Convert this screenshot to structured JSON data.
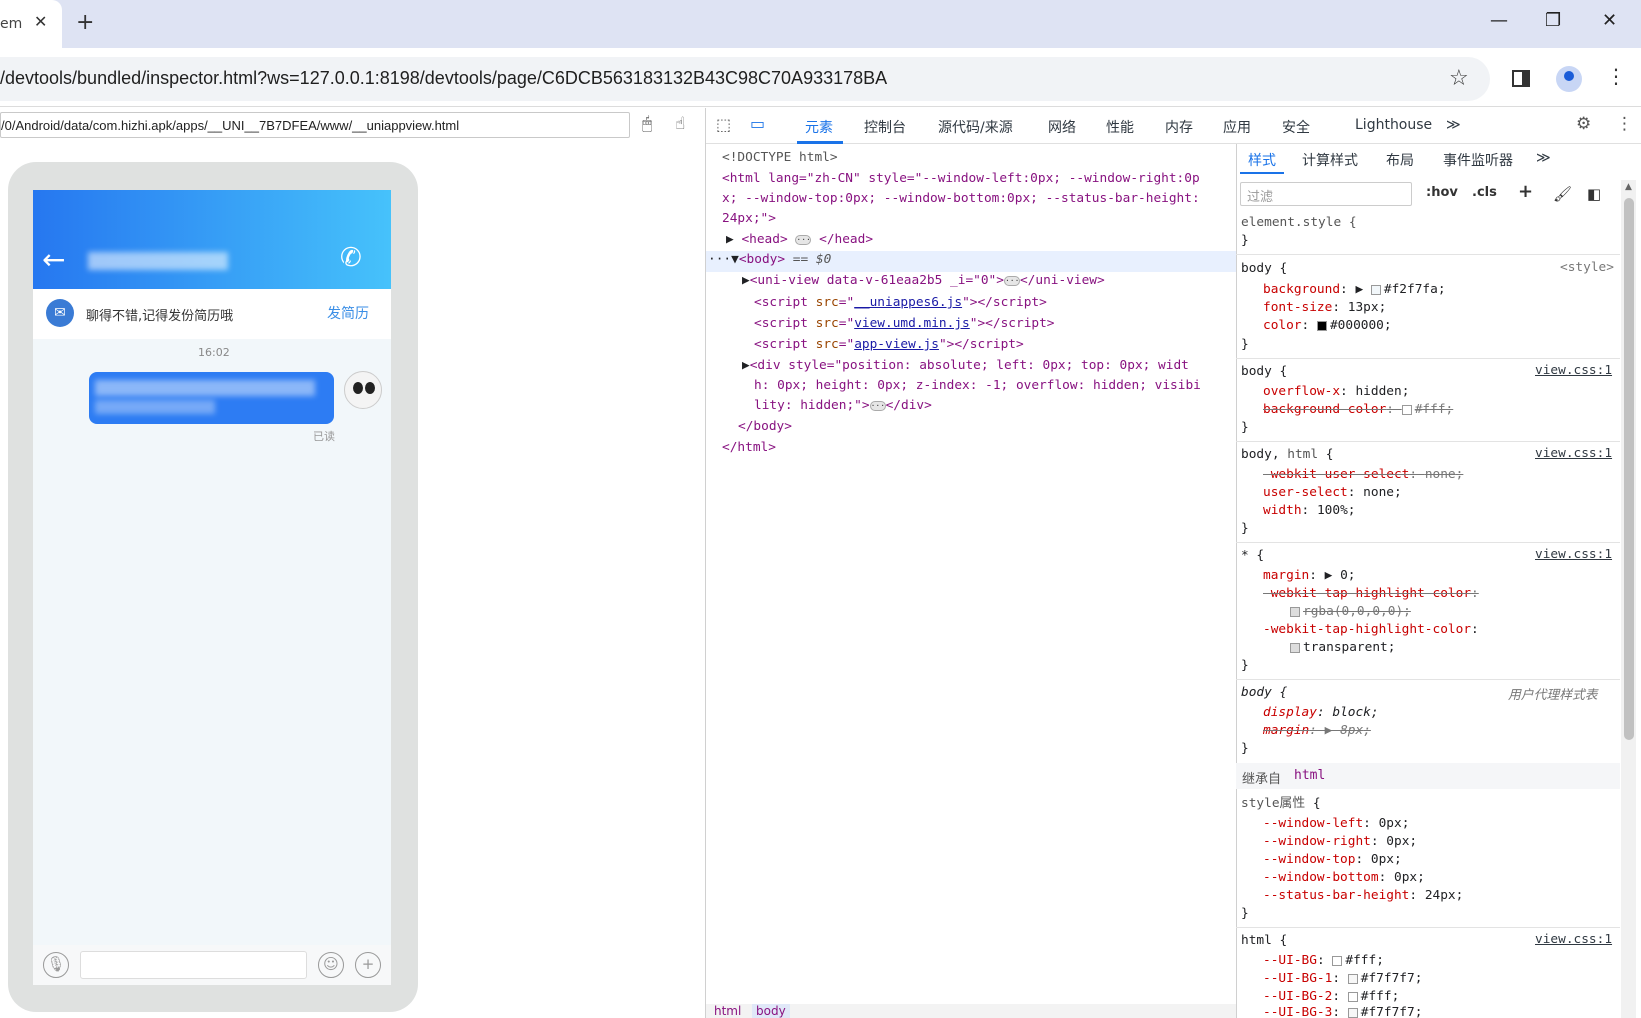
{
  "browser": {
    "tab_title": "em",
    "url": "/devtools/bundled/inspector.html?ws=127.0.0.1:8198/devtools/page/C6DCB563183132B43C98C70A933178BA"
  },
  "screencast": {
    "url": "/0/Android/data/com.hizhi.apk/apps/__UNI__7B7DFEA/www/__uniappview.html"
  },
  "app": {
    "notice": "聊得不错,记得发份简历哦",
    "resume_button": "发简历",
    "message_time": "16:02",
    "read_status": "已读"
  },
  "devtools": {
    "tabs": [
      "元素",
      "控制台",
      "源代码/来源",
      "网络",
      "性能",
      "内存",
      "应用",
      "安全",
      "Lighthouse"
    ],
    "style_tabs": [
      "样式",
      "计算样式",
      "布局",
      "事件监听器"
    ],
    "filter_placeholder": "过滤",
    "hov": ":hov",
    "cls": ".cls",
    "elements": {
      "doctype": "<!DOCTYPE html>",
      "html_open_1": "<html lang=\"zh-CN\" style=\"--window-left:0px; --window-right:0p",
      "html_open_2": "x; --window-top:0px; --window-bottom:0px; --status-bar-height:",
      "html_open_3": "24px;\">",
      "head": "<head>",
      "head_close": "</head>",
      "body": "<body>",
      "body_eq": "== $0",
      "uniview": "<uni-view data-v-61eaa2b5 _i=\"0\">",
      "uniview_close": "</uni-view>",
      "script1_src": "__uniappes6.js",
      "script2_src": "view.umd.min.js",
      "script3_src": "app-view.js",
      "div_1": "<div style=\"position: absolute; left: 0px; top: 0px; widt",
      "div_2": "h: 0px; height: 0px; z-index: -1; overflow: hidden; visibi",
      "div_3": "lity: hidden;\">",
      "div_close": "</div>",
      "body_close": "</body>",
      "html_close": "</html>"
    },
    "breadcrumb": [
      "html",
      "body"
    ],
    "styles": {
      "element_style": "element.style {",
      "style_source": "<style>",
      "view_css": "view.css:1",
      "user_agent": "用户代理样式表",
      "inherited_from": "继承自",
      "inherited_tag": "html",
      "style_attr": "style属性",
      "bg_value": "#f2f7fa",
      "font_size": "13px",
      "color_value": "#000000",
      "overflow_x": "hidden",
      "bg_color_struck": "#fff",
      "user_select": "none",
      "width": "100%",
      "margin": "0",
      "tap_struck": "rgba(0,0,0,0)",
      "tap_value": "transparent",
      "display": "block",
      "ua_margin": "8px",
      "vars": [
        {
          "name": "--window-left",
          "value": "0px"
        },
        {
          "name": "--window-right",
          "value": "0px"
        },
        {
          "name": "--window-top",
          "value": "0px"
        },
        {
          "name": "--window-bottom",
          "value": "0px"
        },
        {
          "name": "--status-bar-height",
          "value": "24px"
        }
      ],
      "ui_bg": [
        {
          "name": "--UI-BG",
          "value": "#fff"
        },
        {
          "name": "--UI-BG-1",
          "value": "#f7f7f7"
        },
        {
          "name": "--UI-BG-2",
          "value": "#fff"
        },
        {
          "name": "--UI-BG-3",
          "value": "#f7f7f7"
        }
      ]
    }
  },
  "colors": {
    "accent": "#1a73e8",
    "app_header_start": "#2677f0",
    "app_header_end": "#46c2fb",
    "bubble": "#2d7cf3"
  }
}
